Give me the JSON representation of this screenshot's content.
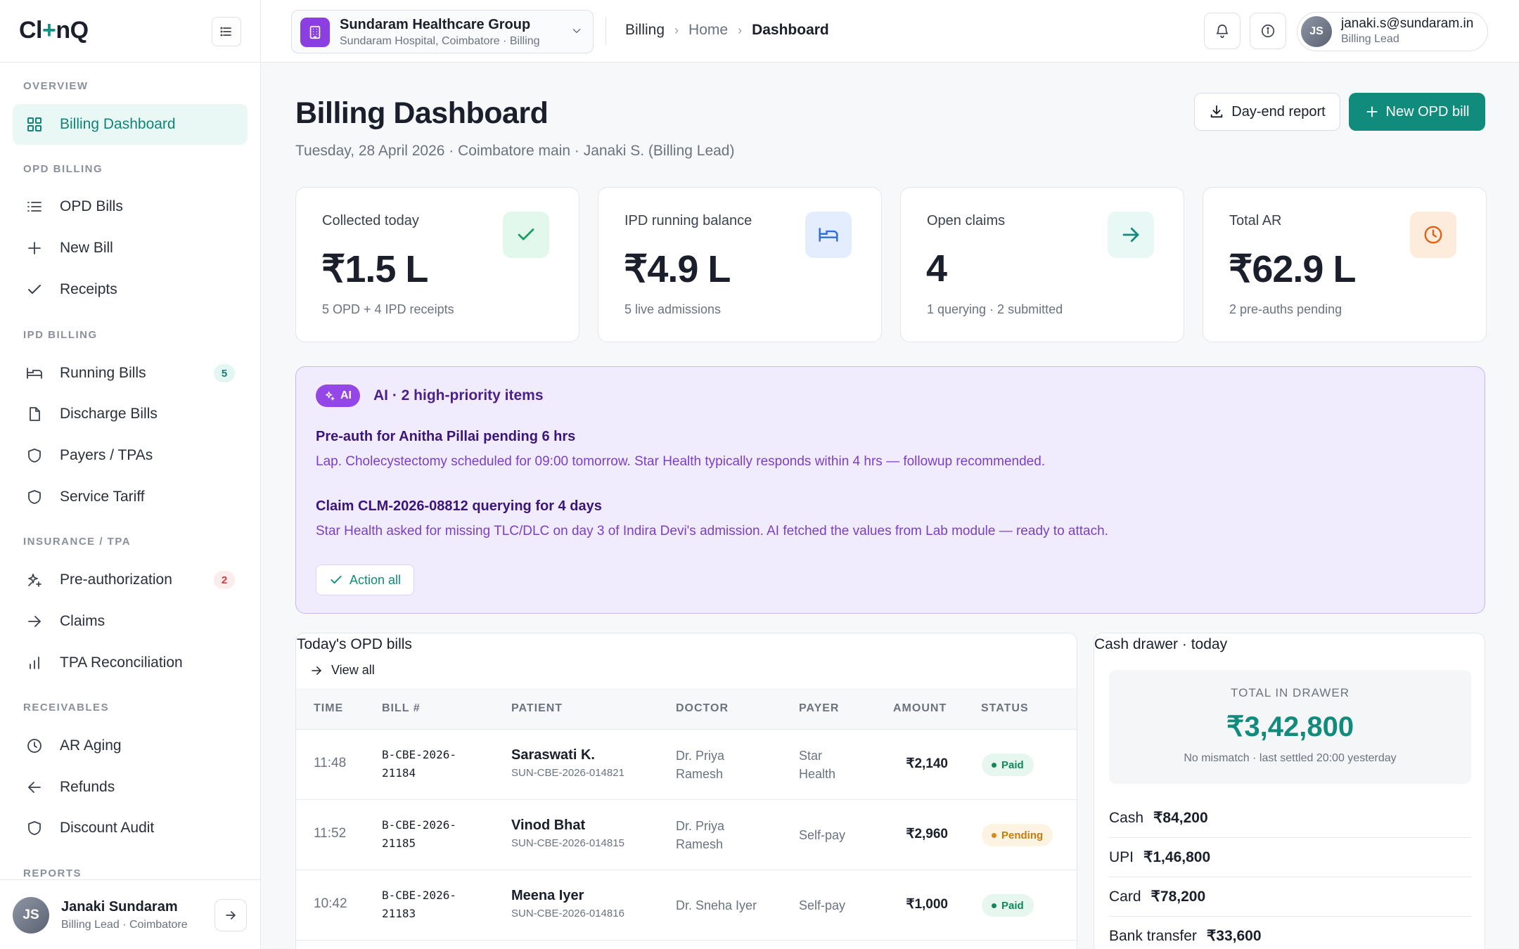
{
  "brand": {
    "logo_left": "Cl",
    "logo_plus": "+",
    "logo_right": "nQ",
    "accent": "#108b7c"
  },
  "sidebar": {
    "sections": [
      {
        "label": "OVERVIEW"
      },
      {
        "label": "OPD BILLING"
      },
      {
        "label": "IPD BILLING"
      },
      {
        "label": "INSURANCE / TPA"
      },
      {
        "label": "RECEIVABLES"
      },
      {
        "label": "REPORTS"
      }
    ],
    "items": [
      {
        "label": "Billing Dashboard",
        "icon": "grid-icon",
        "active": true
      },
      {
        "label": "OPD Bills",
        "icon": "list-icon"
      },
      {
        "label": "New Bill",
        "icon": "plus-icon"
      },
      {
        "label": "Receipts",
        "icon": "check-icon"
      },
      {
        "label": "Running Bills",
        "icon": "bed-icon",
        "badge": "5"
      },
      {
        "label": "Discharge Bills",
        "icon": "file-icon"
      },
      {
        "label": "Payers / TPAs",
        "icon": "shield-icon"
      },
      {
        "label": "Service Tariff",
        "icon": "shield-icon"
      },
      {
        "label": "Pre-authorization",
        "icon": "sparkles-icon",
        "badge": "2"
      },
      {
        "label": "Claims",
        "icon": "arrow-right-icon"
      },
      {
        "label": "TPA Reconciliation",
        "icon": "bar-chart-icon"
      },
      {
        "label": "AR Aging",
        "icon": "clock-icon"
      },
      {
        "label": "Refunds",
        "icon": "arrow-left-icon"
      },
      {
        "label": "Discount Audit",
        "icon": "shield-icon"
      }
    ],
    "user": {
      "initials": "JS",
      "name": "Janaki Sundaram",
      "role": "Billing Lead · Coimbatore"
    }
  },
  "topbar": {
    "org_name": "Sundaram Healthcare Group",
    "org_sub": "Sundaram Hospital, Coimbatore · Billing",
    "breadcrumb": [
      "Billing",
      "Home",
      "Dashboard"
    ],
    "user_initials": "JS",
    "user_email": "janaki.s@sundaram.in",
    "user_role": "Billing Lead"
  },
  "header": {
    "title": "Billing Dashboard",
    "subtitle": "Tuesday, 28 April 2026 · Coimbatore main · Janaki S. (Billing Lead)",
    "report_button": "Day-end report",
    "new_bill_button": "New OPD bill"
  },
  "stats": [
    {
      "label": "Collected today",
      "value": "₹1.5 L",
      "foot": "5 OPD + 4 IPD receipts",
      "icon": "check-icon",
      "icon_bg": "#e3f8ec",
      "icon_color": "#16a061"
    },
    {
      "label": "IPD running balance",
      "value": "₹4.9 L",
      "foot": "5 live admissions",
      "icon": "bed-icon",
      "icon_bg": "#e4edfd",
      "icon_color": "#2f6fd8"
    },
    {
      "label": "Open claims",
      "value": "4",
      "foot": "1 querying · 2 submitted",
      "icon": "arrow-right-icon",
      "icon_bg": "#e8f8f5",
      "icon_color": "#108b7c"
    },
    {
      "label": "Total AR",
      "value": "₹62.9 L",
      "foot": "2 pre-auths pending",
      "icon": "clock-icon",
      "icon_bg": "#fdebdc",
      "icon_color": "#e0641a"
    }
  ],
  "ai": {
    "chip": "AI",
    "heading": "AI · 2 high-priority items",
    "items": [
      {
        "title": "Pre-auth for Anitha Pillai pending 6 hrs",
        "desc": "Lap. Cholecystectomy scheduled for 09:00 tomorrow. Star Health typically responds within 4 hrs — followup recommended."
      },
      {
        "title": "Claim CLM-2026-08812 querying for 4 days",
        "desc": "Star Health asked for missing TLC/DLC on day 3 of Indira Devi's admission. AI fetched the values from Lab module — ready to attach."
      }
    ],
    "action": "Action all"
  },
  "opd": {
    "title": "Today's OPD bills",
    "view_all": "View all",
    "columns": [
      "TIME",
      "BILL #",
      "PATIENT",
      "DOCTOR",
      "PAYER",
      "AMOUNT",
      "STATUS"
    ],
    "rows": [
      {
        "time": "11:48",
        "bill_a": "B-CBE-2026-",
        "bill_b": "21184",
        "patient": "Saraswati K.",
        "pid": "SUN-CBE-2026-014821",
        "doctor_a": "Dr. Priya",
        "doctor_b": "Ramesh",
        "payer_a": "Star",
        "payer_b": "Health",
        "amount": "₹2,140",
        "status": "Paid"
      },
      {
        "time": "11:52",
        "bill_a": "B-CBE-2026-",
        "bill_b": "21185",
        "patient": "Vinod Bhat",
        "pid": "SUN-CBE-2026-014815",
        "doctor_a": "Dr. Priya",
        "doctor_b": "Ramesh",
        "payer_a": "Self-pay",
        "payer_b": "",
        "amount": "₹2,960",
        "status": "Pending"
      },
      {
        "time": "10:42",
        "bill_a": "B-CBE-2026-",
        "bill_b": "21183",
        "patient": "Meena Iyer",
        "pid": "SUN-CBE-2026-014816",
        "doctor_a": "Dr. Sneha Iyer",
        "doctor_b": "",
        "payer_a": "Self-pay",
        "payer_b": "",
        "amount": "₹1,000",
        "status": "Paid"
      }
    ]
  },
  "cash": {
    "title": "Cash drawer · today",
    "total_label": "TOTAL IN DRAWER",
    "total": "₹3,42,800",
    "note": "No mismatch · last settled 20:00 yesterday",
    "rows": [
      {
        "label": "Cash",
        "value": "₹84,200"
      },
      {
        "label": "UPI",
        "value": "₹1,46,800"
      },
      {
        "label": "Card",
        "value": "₹78,200"
      },
      {
        "label": "Bank transfer",
        "value": "₹33,600"
      }
    ]
  }
}
